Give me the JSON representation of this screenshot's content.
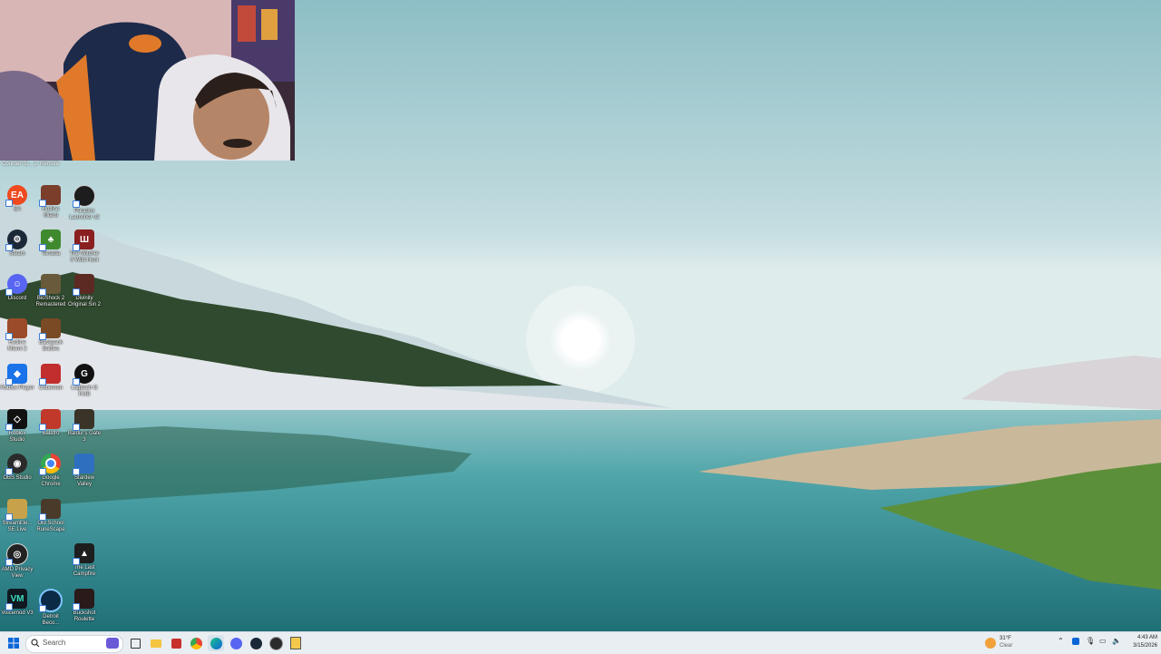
{
  "colors": {
    "taskbar_bg": "#e9eef2",
    "sky_top": "#8fbfc6",
    "water": "#2e8f95",
    "accent": "#0a66d8"
  },
  "webcam": {
    "tags": [
      "Counter-St... 2",
      "Remote"
    ]
  },
  "desktop": {
    "icons": [
      {
        "label": "EA",
        "color": "#f0491f",
        "icon": "ea-icon",
        "round": true
      },
      {
        "label": "Hotline\nMiami",
        "color": "#7a3e2b",
        "icon": "hotline-miami-icon"
      },
      {
        "label": "Paradox\nLauncher v2",
        "color": "#1d1d1d",
        "icon": "paradox-icon",
        "round": true
      },
      {
        "label": "Steam",
        "color": "#1b2838",
        "icon": "steam-icon",
        "round": true
      },
      {
        "label": "Terraria",
        "color": "#3f8a2f",
        "icon": "terraria-icon"
      },
      {
        "label": "The Witcher\n3 Wild Hunt",
        "color": "#8a1f1f",
        "icon": "witcher-icon"
      },
      {
        "label": "Discord",
        "color": "#5865f2",
        "icon": "discord-icon",
        "round": true
      },
      {
        "label": "BioShock 2\nRemastered",
        "color": "#6a5a3c",
        "icon": "bioshock-icon"
      },
      {
        "label": "Divinity\nOriginal Sin 2",
        "color": "#5c2a22",
        "icon": "divinity-icon"
      },
      {
        "label": "Hotline\nMiami 2",
        "color": "#9b4b2a",
        "icon": "hotline-miami-2-icon"
      },
      {
        "label": "Backpack\nBattles",
        "color": "#7a4a25",
        "icon": "backpack-battles-icon"
      },
      {
        "label": "Roblox Player",
        "color": "#1a73e8",
        "icon": "roblox-player-icon"
      },
      {
        "label": "Cubemen",
        "color": "#c22d2d",
        "icon": "cubemen-icon"
      },
      {
        "label": "Logitech G\nHUB",
        "color": "#111111",
        "icon": "logitech-icon",
        "round": true
      },
      {
        "label": "Roblox\nStudio",
        "color": "#111111",
        "icon": "roblox-studio-icon"
      },
      {
        "label": "Balatro",
        "color": "#c0392b",
        "icon": "balatro-icon"
      },
      {
        "label": "Baldur's Gate\n3",
        "color": "#3a3328",
        "icon": "baldurs-gate-icon"
      },
      {
        "label": "OBS Studio",
        "color": "#2b2b2b",
        "icon": "obs-icon",
        "round": true
      },
      {
        "label": "Google\nChrome",
        "color": "#ea4335",
        "icon": "chrome-icon",
        "round": true
      },
      {
        "label": "Stardew\nValley",
        "color": "#2f6fbf",
        "icon": "stardew-icon"
      },
      {
        "label": "StreamEle...\nSE.Live",
        "color": "#c8a24a",
        "icon": "streamelements-icon"
      },
      {
        "label": "Old School\nRuneScape",
        "color": "#4a3a2a",
        "icon": "runescape-icon"
      },
      {
        "label": "AMD Privacy\nView",
        "color": "#222222",
        "icon": "amd-icon",
        "round": true
      },
      {
        "label": "The Last\nCampfire",
        "color": "#1e1e1e",
        "icon": "last-campfire-icon"
      },
      {
        "label": "Voicemod V3",
        "color": "#101820",
        "icon": "voicemod-icon"
      },
      {
        "label": "Detroit\nBeco...",
        "color": "#0b2a45",
        "icon": "detroit-icon",
        "round": true
      },
      {
        "label": "Buckshot\nRoulette",
        "color": "#2a1a1a",
        "icon": "buckshot-icon"
      }
    ]
  },
  "taskbar": {
    "search_placeholder": "Search",
    "apps": [
      "file-explorer-icon",
      "roblox-taskbar-icon",
      "chrome-taskbar-icon",
      "edge-icon",
      "discord-taskbar-icon",
      "steam-taskbar-icon",
      "obs-taskbar-icon",
      "notepad-icon"
    ],
    "weather": {
      "temp": "31°F",
      "cond": "Clear"
    },
    "time": "4:43 AM",
    "date": "3/15/2026"
  }
}
